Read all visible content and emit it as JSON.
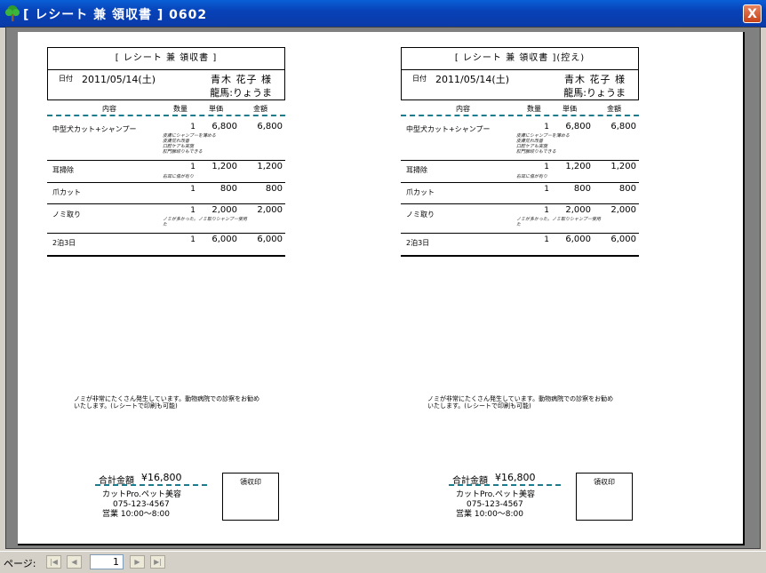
{
  "window": {
    "title": "[ レシート 兼 領収書 ] 0602",
    "icon": "tree-icon",
    "close_label": "X",
    "accent": "#0842b8"
  },
  "receipts": [
    {
      "heading": "[ レシート 兼 領収書 ]",
      "date_label": "日付",
      "date": "2011/05/14(土)",
      "customer": "青木 花子 様",
      "pet": "龍馬:りょうま",
      "columns": {
        "item": "内容",
        "qty": "数量",
        "price": "単価",
        "amount": "金額"
      },
      "rows": [
        {
          "item": "中型犬カット+シャンプー",
          "qty": "1",
          "price": "6,800",
          "amount": "6,800",
          "note": "皮膚にシャンプーを薄める\n皮膚荒れ改善\n口腔ケアも実施\n肛門腺絞りもできる"
        },
        {
          "item": "耳掃除",
          "qty": "1",
          "price": "1,200",
          "amount": "1,200",
          "note": "右耳に傷が有り"
        },
        {
          "item": "爪カット",
          "qty": "1",
          "price": "800",
          "amount": "800",
          "note": ""
        },
        {
          "item": "ノミ取り",
          "qty": "1",
          "price": "2,000",
          "amount": "2,000",
          "note": "ノミが多かった。ノミ取りシャンプー使用\nた"
        },
        {
          "item": "2泊3日",
          "qty": "1",
          "price": "6,000",
          "amount": "6,000",
          "note": ""
        }
      ],
      "message": "ノミが非常にたくさん発生しています。動物病院での診察をお勧め\nいたします。(レシートで印刷も可能)",
      "total_label": "合計金額",
      "total_value": "¥16,800",
      "shop_name": "カットPro.ペット美容",
      "shop_phone": "075-123-4567",
      "shop_hours": "営業 10:00〜8:00",
      "stamp_label": "領収印"
    },
    {
      "heading": "[ レシート 兼 領収書 ](控え)",
      "date_label": "日付",
      "date": "2011/05/14(土)",
      "customer": "青木 花子 様",
      "pet": "龍馬:りょうま",
      "columns": {
        "item": "内容",
        "qty": "数量",
        "price": "単価",
        "amount": "金額"
      },
      "rows": [
        {
          "item": "中型犬カット+シャンプー",
          "qty": "1",
          "price": "6,800",
          "amount": "6,800",
          "note": "皮膚にシャンプーを薄める\n皮膚荒れ改善\n口腔ケアも実施\n肛門腺絞りもできる"
        },
        {
          "item": "耳掃除",
          "qty": "1",
          "price": "1,200",
          "amount": "1,200",
          "note": "右耳に傷が有り"
        },
        {
          "item": "爪カット",
          "qty": "1",
          "price": "800",
          "amount": "800",
          "note": ""
        },
        {
          "item": "ノミ取り",
          "qty": "1",
          "price": "2,000",
          "amount": "2,000",
          "note": "ノミが多かった。ノミ取りシャンプー使用\nた"
        },
        {
          "item": "2泊3日",
          "qty": "1",
          "price": "6,000",
          "amount": "6,000",
          "note": ""
        }
      ],
      "message": "ノミが非常にたくさん発生しています。動物病院での診察をお勧め\nいたします。(レシートで印刷も可能)",
      "total_label": "合計金額",
      "total_value": "¥16,800",
      "shop_name": "カットPro.ペット美容",
      "shop_phone": "075-123-4567",
      "shop_hours": "営業 10:00〜8:00",
      "stamp_label": "領収印"
    }
  ],
  "statusbar": {
    "page_label": "ページ:",
    "page_value": "1",
    "nav_icons": [
      "first-page-icon",
      "prev-page-icon",
      "next-page-icon",
      "last-page-icon"
    ]
  }
}
